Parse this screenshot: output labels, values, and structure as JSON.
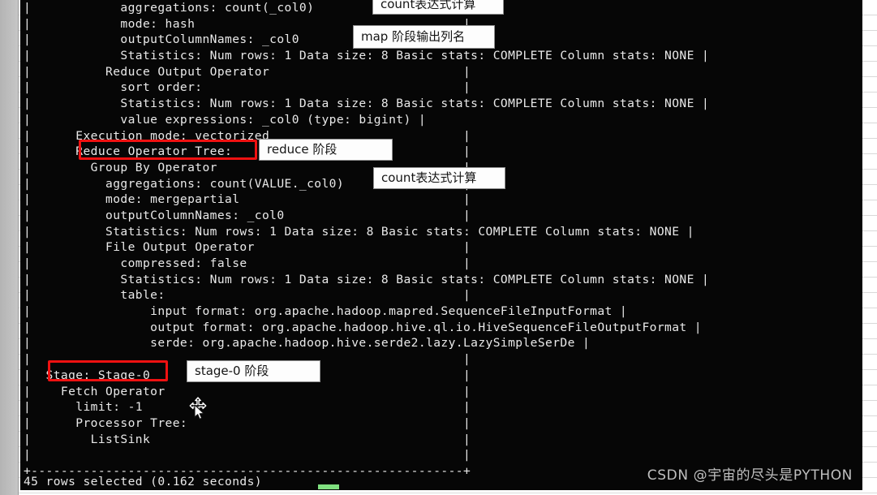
{
  "terminal": {
    "lines": [
      "|            aggregations: count(_col0)                    |",
      "|            mode: hash                                    |",
      "|            outputColumnNames: _col0                      |",
      "|            Statistics: Num rows: 1 Data size: 8 Basic stats: COMPLETE Column stats: NONE |",
      "|          Reduce Output Operator                          |",
      "|            sort order:                                   |",
      "|            Statistics: Num rows: 1 Data size: 8 Basic stats: COMPLETE Column stats: NONE |",
      "|            value expressions: _col0 (type: bigint) |",
      "|      Execution mode: vectorized                          |",
      "|      Reduce Operator Tree:                               |",
      "|        Group By Operator                                 |",
      "|          aggregations: count(VALUE._col0)                |",
      "|          mode: mergepartial                              |",
      "|          outputColumnNames: _col0                        |",
      "|          Statistics: Num rows: 1 Data size: 8 Basic stats: COMPLETE Column stats: NONE |",
      "|          File Output Operator                            |",
      "|            compressed: false                             |",
      "|            Statistics: Num rows: 1 Data size: 8 Basic stats: COMPLETE Column stats: NONE |",
      "|            table:                                        |",
      "|                input format: org.apache.hadoop.mapred.SequenceFileInputFormat |",
      "|                output format: org.apache.hadoop.hive.ql.io.HiveSequenceFileOutputFormat |",
      "|                serde: org.apache.hadoop.hive.serde2.lazy.LazySimpleSerDe |",
      "|                                                          |",
      "|  Stage: Stage-0                                          |",
      "|    Fetch Operator                                        |",
      "|      limit: -1                                           |",
      "|      Processor Tree:                                     |",
      "|        ListSink                                          |",
      "|                                                          |",
      "+----------------------------------------------------------+"
    ],
    "status": "45 rows selected (0.162 seconds)"
  },
  "highlights": [
    {
      "id": "reduce-operator-tree",
      "text": "Reduce Operator Tree:"
    },
    {
      "id": "stage-0",
      "text": "Stage: Stage-0"
    }
  ],
  "callouts": [
    {
      "id": "count-expr-map",
      "text": "count表达式计算"
    },
    {
      "id": "map-output-cols",
      "text": "map 阶段输出列名"
    },
    {
      "id": "reduce-phase",
      "text": "reduce 阶段"
    },
    {
      "id": "count-expr-reduce",
      "text": "count表达式计算"
    },
    {
      "id": "stage-0-phase",
      "text": "stage-0 阶段"
    }
  ],
  "watermark": {
    "text": "CSDN @宇宙的尽头是PYTHON"
  },
  "colors": {
    "highlight_red": "#ef1111",
    "terminal_bg": "#060606",
    "terminal_fg": "#e9e9e9",
    "callout_bg": "#fdfdfd",
    "accent_green": "#7fe07f"
  }
}
